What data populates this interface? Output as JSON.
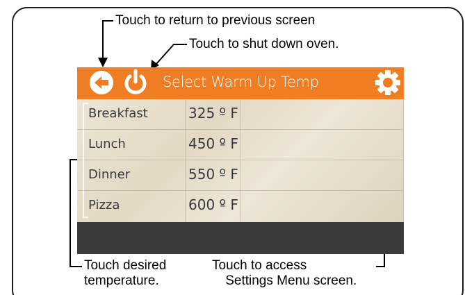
{
  "callouts": {
    "return": "Touch to return to previous screen",
    "shutdown": "Touch to shut down oven.",
    "desired_line1": "Touch desired",
    "desired_line2": "temperature.",
    "settings_line1": "Touch to access",
    "settings_line2": "Settings Menu screen."
  },
  "screen": {
    "title": "Select Warm Up Temp",
    "accent_color": "#ee7d23",
    "footer_color": "#3b3b3b",
    "icons": {
      "back": "back-arrow-icon",
      "power": "power-icon",
      "settings": "gear-icon"
    },
    "rows": [
      {
        "meal": "Breakfast",
        "temp": "325 º F"
      },
      {
        "meal": "Lunch",
        "temp": "450 º F"
      },
      {
        "meal": "Dinner",
        "temp": "550 º F"
      },
      {
        "meal": "Pizza",
        "temp": "600 º F"
      }
    ]
  }
}
